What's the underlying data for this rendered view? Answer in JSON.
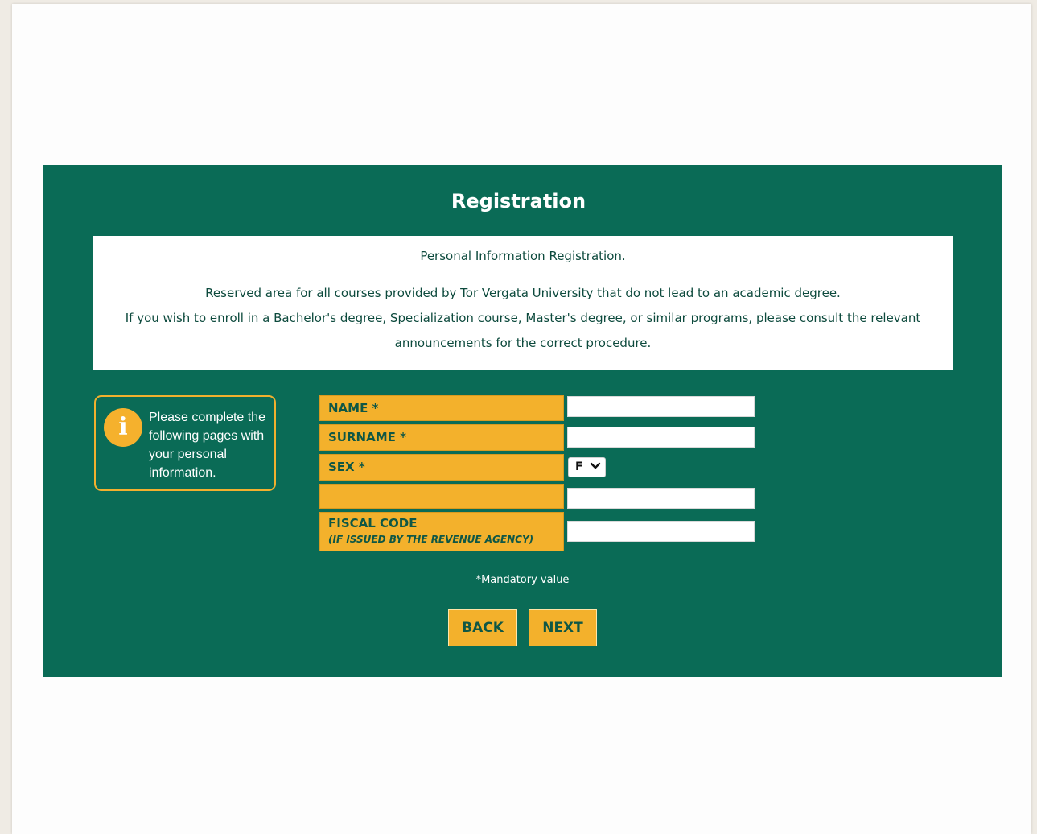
{
  "header": {
    "title": "Registration"
  },
  "notice": {
    "heading": "Personal Information Registration.",
    "line1": "Reserved area for all courses provided by Tor Vergata University that do not lead to an academic degree.",
    "line2": "If you wish to enroll in a Bachelor's degree, Specialization course, Master's degree, or similar programs, please consult the relevant",
    "line3": "announcements for the correct procedure."
  },
  "infobox": {
    "icon": "info-icon",
    "text": "Please complete the following pages with your personal information."
  },
  "form": {
    "name_label": "NAME *",
    "name_value": "",
    "surname_label": "SURNAME *",
    "surname_value": "",
    "sex_label": "SEX *",
    "sex_value": "F",
    "blank_label": "",
    "blank_value": "",
    "fiscal_label": "FISCAL CODE",
    "fiscal_sublabel": "(IF ISSUED BY THE REVENUE AGENCY)",
    "fiscal_value": ""
  },
  "footer": {
    "mandatory_note": "*Mandatory value",
    "back_label": "BACK",
    "next_label": "NEXT"
  },
  "colors": {
    "panel_green": "#0a6b56",
    "accent_yellow": "#f3b12c",
    "label_text": "#0f5745"
  }
}
